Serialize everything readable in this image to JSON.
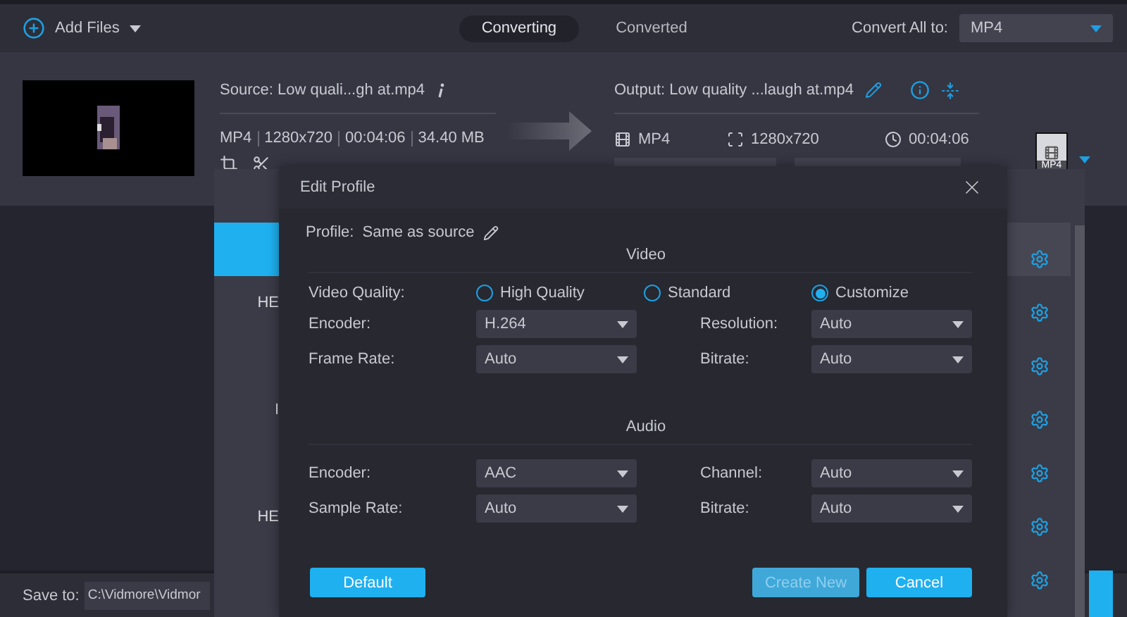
{
  "toolbar": {
    "add_files": "Add Files",
    "tabs": [
      {
        "label": "Converting",
        "selected": true
      },
      {
        "label": "Converted",
        "selected": false
      }
    ],
    "convert_all_label": "Convert All to:",
    "convert_all_value": "MP4"
  },
  "file": {
    "source": "Source: Low quali...gh at.mp4",
    "meta": [
      "MP4",
      "1280x720",
      "00:04:06",
      "34.40 MB"
    ],
    "output": "Output: Low quality ...laugh at.mp4",
    "out_format": "MP4",
    "out_resolution": "1280x720",
    "out_duration": "00:04:06",
    "format_badge": "MP4"
  },
  "save_bar": {
    "label": "Save to:",
    "path": "C:\\Vidmore\\Vidmor"
  },
  "profile_list": [
    {
      "selected": true
    },
    {
      "label": "HE",
      "selected": false
    },
    {
      "selected": false
    },
    {
      "label": "I",
      "selected": false
    },
    {
      "selected": false
    },
    {
      "label": "HE",
      "selected": false
    },
    {
      "selected": false
    }
  ],
  "dialog": {
    "title": "Edit Profile",
    "profile_label": "Profile:",
    "profile_value": "Same as source",
    "video": {
      "title": "Video",
      "quality_label": "Video Quality:",
      "options": [
        {
          "label": "High Quality",
          "selected": false
        },
        {
          "label": "Standard",
          "selected": false
        },
        {
          "label": "Customize",
          "selected": true
        }
      ],
      "rows": [
        {
          "left_label": "Encoder:",
          "left_value": "H.264",
          "right_label": "Resolution:",
          "right_value": "Auto"
        },
        {
          "left_label": "Frame Rate:",
          "left_value": "Auto",
          "right_label": "Bitrate:",
          "right_value": "Auto"
        }
      ]
    },
    "audio": {
      "title": "Audio",
      "rows": [
        {
          "left_label": "Encoder:",
          "left_value": "AAC",
          "right_label": "Channel:",
          "right_value": "Auto"
        },
        {
          "left_label": "Sample Rate:",
          "left_value": "Auto",
          "right_label": "Bitrate:",
          "right_value": "Auto"
        }
      ]
    },
    "buttons": [
      {
        "label": "Default",
        "disabled": false
      },
      {
        "label": "Create New",
        "disabled": true
      },
      {
        "label": "Cancel",
        "disabled": false
      }
    ]
  }
}
